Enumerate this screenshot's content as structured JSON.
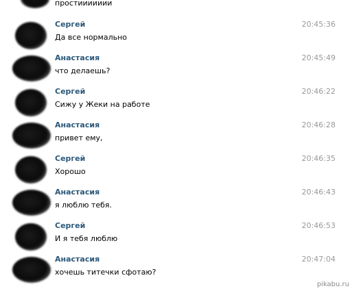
{
  "top_message": {
    "text": "простиииииии"
  },
  "messages": [
    {
      "author": "Сергей",
      "text": "Да все нормально",
      "time": "20:45:36"
    },
    {
      "author": "Анастасия",
      "text": "что делаешь?",
      "time": "20:45:49"
    },
    {
      "author": "Сергей",
      "text": "Сижу у Жеки на работе",
      "time": "20:46:22"
    },
    {
      "author": "Анастасия",
      "text": "привет ему,",
      "time": "20:46:28"
    },
    {
      "author": "Сергей",
      "text": "Хорошо",
      "time": "20:46:35"
    },
    {
      "author": "Анастасия",
      "text": "я люблю тебя.",
      "time": "20:46:43"
    },
    {
      "author": "Сергей",
      "text": "И я тебя люблю",
      "time": "20:46:53"
    },
    {
      "author": "Анастасия",
      "text": "хочешь титечки сфотаю?",
      "time": "20:47:04"
    }
  ],
  "watermark": "pikabu.ru",
  "colors": {
    "author_name": "#2b587a",
    "timestamp": "#999999",
    "message_text": "#000000"
  }
}
